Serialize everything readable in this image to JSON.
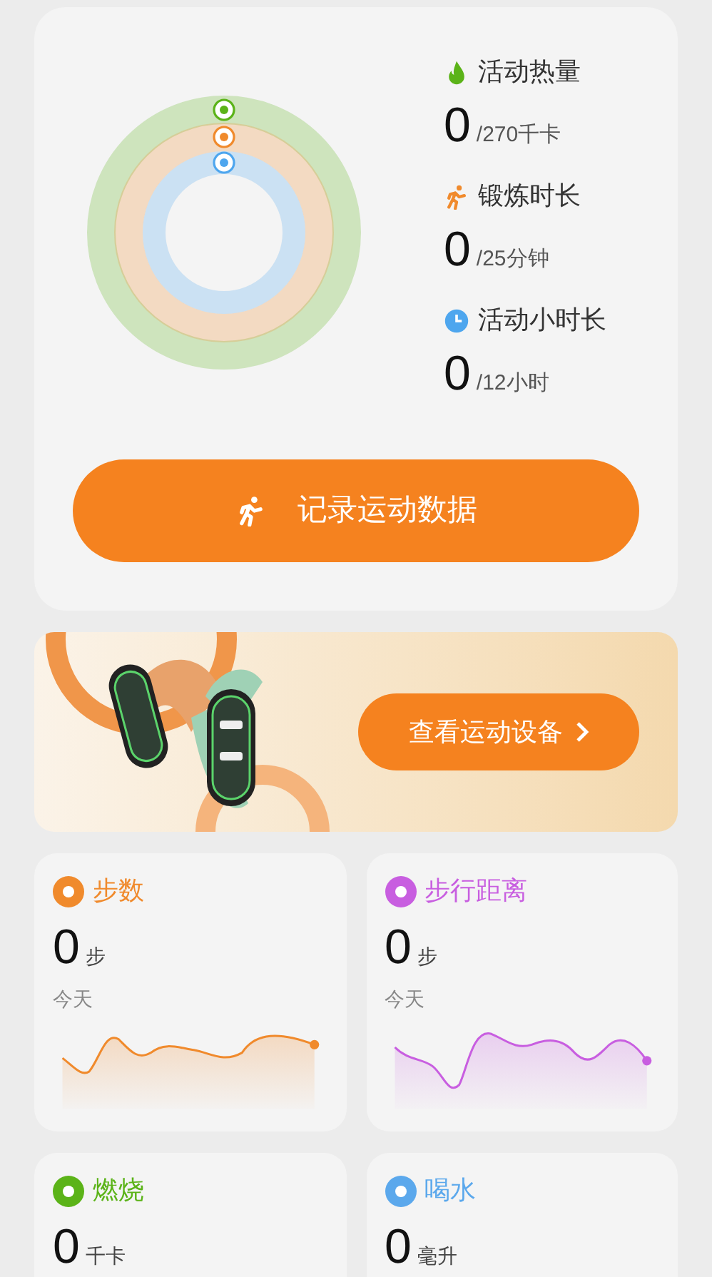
{
  "activity": {
    "metrics": [
      {
        "title": "活动热量",
        "value": "0",
        "goal": "/270千卡",
        "color": "#5bb318"
      },
      {
        "title": "锻炼时长",
        "value": "0",
        "goal": "/25分钟",
        "color": "#f08a2c"
      },
      {
        "title": "活动小时长",
        "value": "0",
        "goal": "/12小时",
        "color": "#4ea6ee"
      }
    ],
    "record_button": "记录运动数据"
  },
  "banner": {
    "kind": "picture",
    "button": "查看运动设备"
  },
  "tiles": [
    {
      "title": "步数",
      "value": "0",
      "unit": "步",
      "period": "今天",
      "color": "#f08a2c"
    },
    {
      "title": "步行距离",
      "value": "0",
      "unit": "步",
      "period": "今天",
      "color": "#c85ee0"
    },
    {
      "title": "燃烧",
      "value": "0",
      "unit": "千卡",
      "color": "#5bb318"
    },
    {
      "title": "喝水",
      "value": "0",
      "unit": "毫升",
      "color": "#5ba8ec"
    }
  ]
}
